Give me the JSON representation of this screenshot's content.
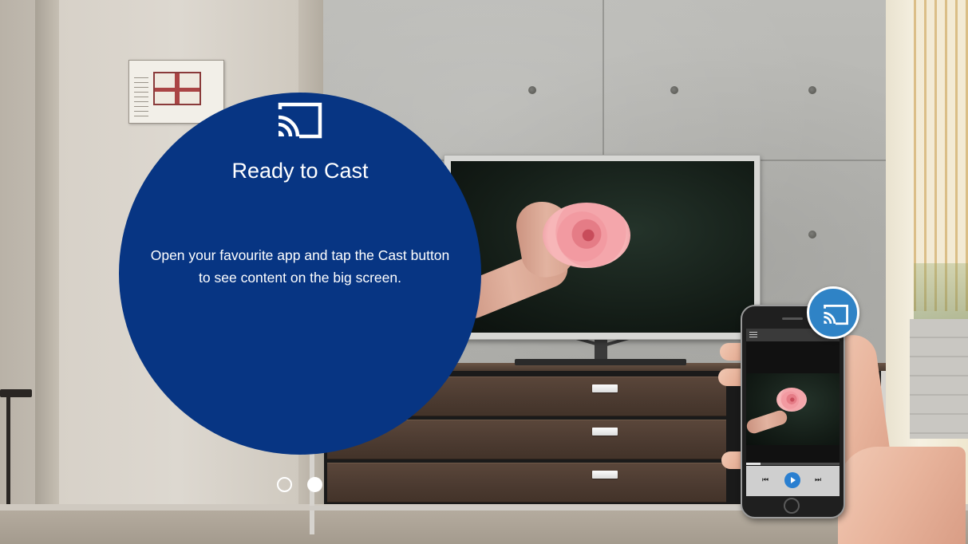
{
  "cast_panel": {
    "title": "Ready to Cast",
    "body": "Open your favourite app and tap the Cast button to see content on the big screen.",
    "icon": "cast-icon",
    "background_color": "#073583"
  },
  "pager": {
    "page_count": 2,
    "current_page": 2
  },
  "phone": {
    "cast_badge_icon": "cast-icon",
    "badge_color": "#2f83c6",
    "controls": {
      "previous_icon": "previous-icon",
      "play_icon": "play-icon",
      "next_icon": "next-icon",
      "previous_glyph": "⏮",
      "next_glyph": "⏭"
    },
    "progress": 0.15
  }
}
